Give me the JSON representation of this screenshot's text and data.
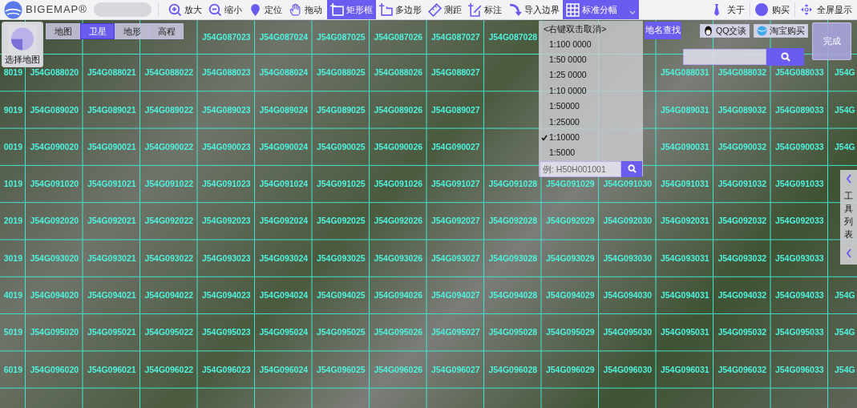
{
  "app": {
    "name": "BIGEMAP®"
  },
  "toolbar": [
    {
      "label": "放大",
      "selected": false
    },
    {
      "label": "缩小",
      "selected": false
    },
    {
      "label": "定位",
      "selected": false
    },
    {
      "label": "拖动",
      "selected": false
    },
    {
      "label": "矩形框",
      "selected": true
    },
    {
      "label": "多边形",
      "selected": false
    },
    {
      "label": "测距",
      "selected": false
    },
    {
      "label": "标注",
      "selected": false
    },
    {
      "label": "导入边界",
      "selected": false
    },
    {
      "label": "标准分幅",
      "selected": true
    }
  ],
  "toolbar_right": [
    {
      "label": "关于"
    },
    {
      "label": "购买"
    },
    {
      "label": "全屏显示"
    }
  ],
  "map_selector": {
    "label": "选择地图"
  },
  "map_types": [
    {
      "label": "地图",
      "selected": false
    },
    {
      "label": "卫星",
      "selected": true
    },
    {
      "label": "地形",
      "selected": false
    },
    {
      "label": "高程",
      "selected": false
    }
  ],
  "scale_menu": {
    "hint": "<右键双击取消>",
    "items": [
      {
        "label": "1:100 0000",
        "checked": false
      },
      {
        "label": "1:50 0000",
        "checked": false
      },
      {
        "label": "1:25 0000",
        "checked": false
      },
      {
        "label": "1:10 0000",
        "checked": false
      },
      {
        "label": "1:50000",
        "checked": false
      },
      {
        "label": "1:25000",
        "checked": false
      },
      {
        "label": "1:10000",
        "checked": true
      },
      {
        "label": "1:5000",
        "checked": false
      }
    ],
    "search": {
      "placeholder": "例: H50H001001"
    }
  },
  "place_search": {
    "tab": "地名查找"
  },
  "contact_buttons": [
    {
      "label": "QQ交谈"
    },
    {
      "label": "淘宝购买"
    }
  ],
  "done_button": {
    "label": "完成"
  },
  "side_panel": {
    "label": "工具列表"
  },
  "grid": [
    {
      "cells": [
        null,
        null,
        null,
        "J54G087023",
        "J54G087024",
        "J54G087025",
        "J54G087026",
        "J54G087027",
        "J54G087028",
        null,
        null,
        null,
        null,
        null
      ]
    },
    {
      "lead": "8019",
      "cells": [
        "J54G088020",
        "J54G088021",
        "J54G088022",
        "J54G088023",
        "J54G088024",
        "J54G088025",
        "J54G088026",
        "J54G088027",
        null,
        null,
        null,
        "J54G088031",
        "J54G088032",
        "J54G088033"
      ],
      "tail": "J54G"
    },
    {
      "lead": "9019",
      "cells": [
        "J54G089020",
        "J54G089021",
        "J54G089022",
        "J54G089023",
        "J54G089024",
        "J54G089025",
        "J54G089026",
        "J54G089027",
        null,
        null,
        null,
        "J54G089031",
        "J54G089032",
        "J54G089033"
      ],
      "tail": "J54G"
    },
    {
      "lead": "0019",
      "cells": [
        "J54G090020",
        "J54G090021",
        "J54G090022",
        "J54G090023",
        "J54G090024",
        "J54G090025",
        "J54G090026",
        "J54G090027",
        null,
        null,
        null,
        "J54G090031",
        "J54G090032",
        "J54G090033"
      ],
      "tail": "J54G"
    },
    {
      "lead": "1019",
      "cells": [
        "J54G091020",
        "J54G091021",
        "J54G091022",
        "J54G091023",
        "J54G091024",
        "J54G091025",
        "J54G091026",
        "J54G091027",
        "J54G091028",
        "J54G091029",
        "J54G091030",
        "J54G091031",
        "J54G091032",
        "J54G091033"
      ]
    },
    {
      "lead": "2019",
      "cells": [
        "J54G092020",
        "J54G092021",
        "J54G092022",
        "J54G092023",
        "J54G092024",
        "J54G092025",
        "J54G092026",
        "J54G092027",
        "J54G092028",
        "J54G092029",
        "J54G092030",
        "J54G092031",
        "J54G092032",
        "J54G092033"
      ]
    },
    {
      "lead": "3019",
      "cells": [
        "J54G093020",
        "J54G093021",
        "J54G093022",
        "J54G093023",
        "J54G093024",
        "J54G093025",
        "J54G093026",
        "J54G093027",
        "J54G093028",
        "J54G093029",
        "J54G093030",
        "J54G093031",
        "J54G093032",
        "J54G093033"
      ]
    },
    {
      "lead": "4019",
      "cells": [
        "J54G094020",
        "J54G094021",
        "J54G094022",
        "J54G094023",
        "J54G094024",
        "J54G094025",
        "J54G094026",
        "J54G094027",
        "J54G094028",
        "J54G094029",
        "J54G094030",
        "J54G094031",
        "J54G094032",
        "J54G094033"
      ],
      "tail": "J54G"
    },
    {
      "lead": "5019",
      "cells": [
        "J54G095020",
        "J54G095021",
        "J54G095022",
        "J54G095023",
        "J54G095024",
        "J54G095025",
        "J54G095026",
        "J54G095027",
        "J54G095028",
        "J54G095029",
        "J54G095030",
        "J54G095031",
        "J54G095032",
        "J54G095033"
      ],
      "tail": "J54G"
    },
    {
      "lead": "6019",
      "cells": [
        "J54G096020",
        "J54G096021",
        "J54G096022",
        "J54G096023",
        "J54G096024",
        "J54G096025",
        "J54G096026",
        "J54G096027",
        "J54G096028",
        "J54G096029",
        "J54G096030",
        "J54G096031",
        "J54G096032",
        "J54G096033"
      ],
      "tail": "J54G"
    }
  ]
}
